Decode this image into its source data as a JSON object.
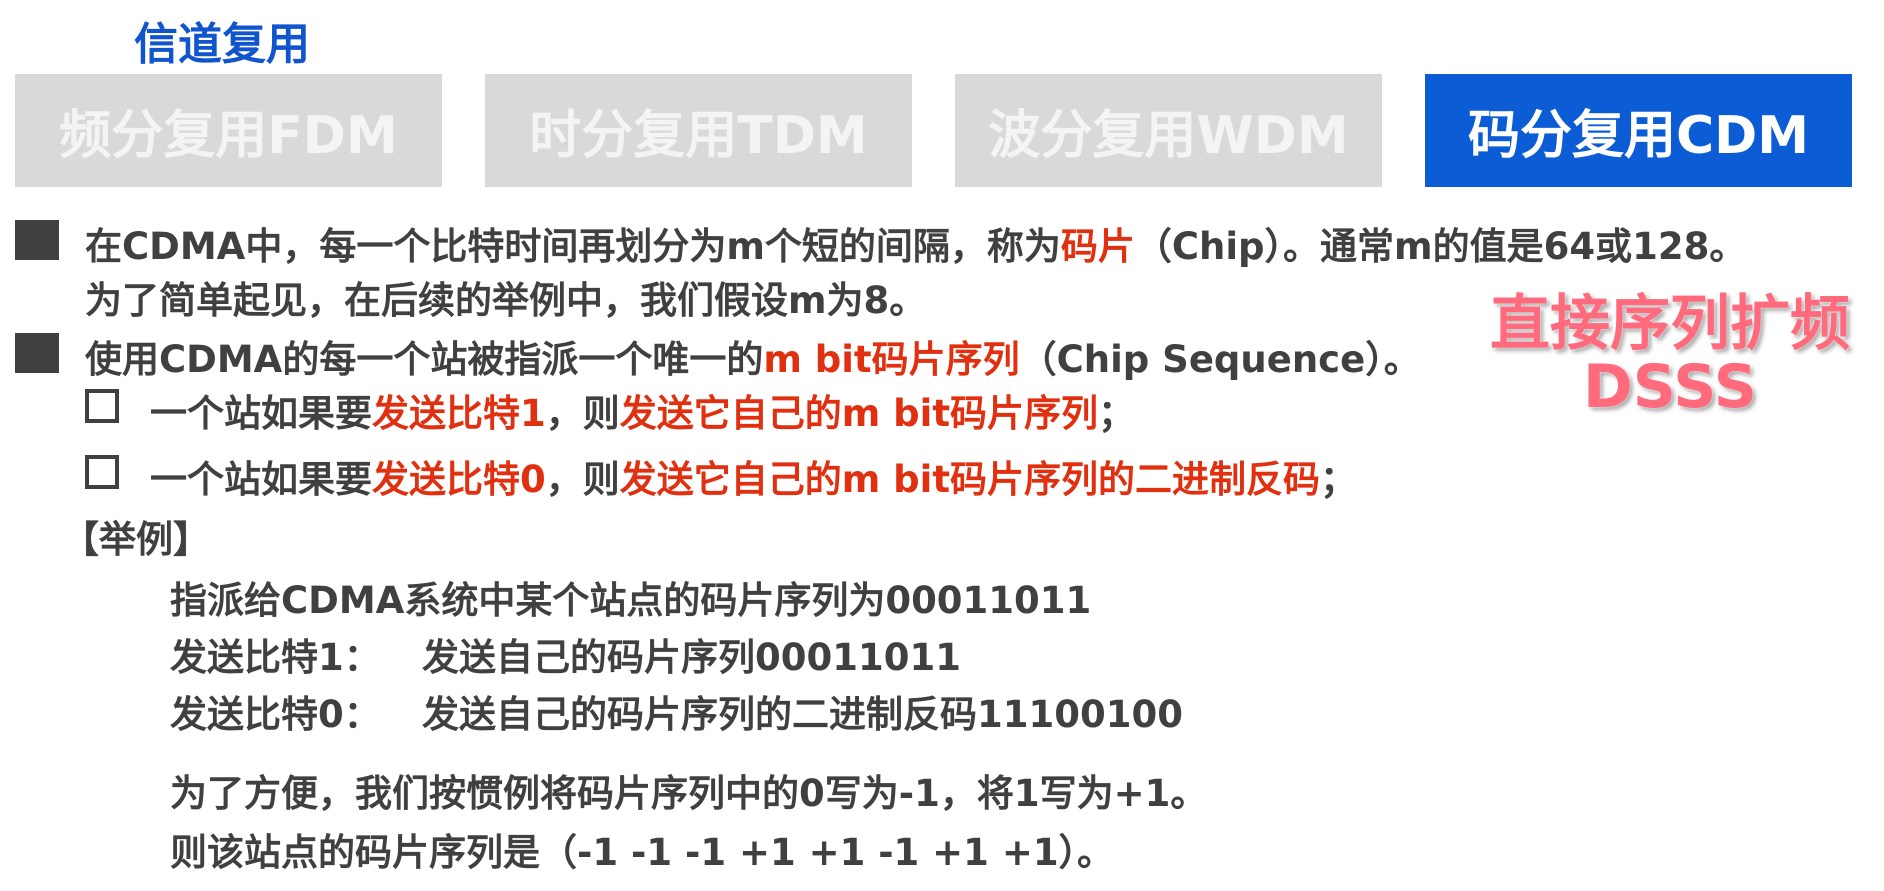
{
  "title": "信道复用",
  "tabs": [
    {
      "label": "频分复用FDM"
    },
    {
      "label": "时分复用TDM"
    },
    {
      "label": "波分复用WDM"
    },
    {
      "label": "码分复用CDM"
    }
  ],
  "accent_color": "#0b5cd5",
  "highlight_color": "#e03010",
  "bullet1": {
    "pre": "在CDMA中，每一个比特时间再划分为m个短的间隔，称为",
    "red": "码片",
    "post": "（Chip）。通常m的值是64或128。",
    "line2": "为了简单起见，在后续的举例中，我们假设m为8。"
  },
  "bullet2": {
    "pre": "使用CDMA的每一个站被指派一个唯一的",
    "red": "m bit码片序列",
    "post": "（Chip Sequence）。"
  },
  "sub1": {
    "pre": "一个站如果要",
    "red1": "发送比特1",
    "mid": "，则",
    "red2": "发送它自己的m bit码片序列",
    "post": "；"
  },
  "sub2": {
    "pre": "一个站如果要",
    "red1": "发送比特0",
    "mid": "，则",
    "red2": "发送它自己的m bit码片序列的二进制反码",
    "post": "；"
  },
  "example": {
    "heading": "【举例】",
    "line1": "指派给CDMA系统中某个站点的码片序列为00011011",
    "line2_label": "发送比特1：",
    "line2_value": "发送自己的码片序列00011011",
    "line3_label": "发送比特0：",
    "line3_value": "发送自己的码片序列的二进制反码11100100",
    "line4": "为了方便，我们按惯例将码片序列中的0写为-1，将1写为+1。",
    "line5": "则该站点的码片序列是（-1 -1 -1 +1 +1 -1 +1 +1）。"
  },
  "overlay": {
    "line1": "直接序列扩频",
    "line2": "DSSS"
  }
}
